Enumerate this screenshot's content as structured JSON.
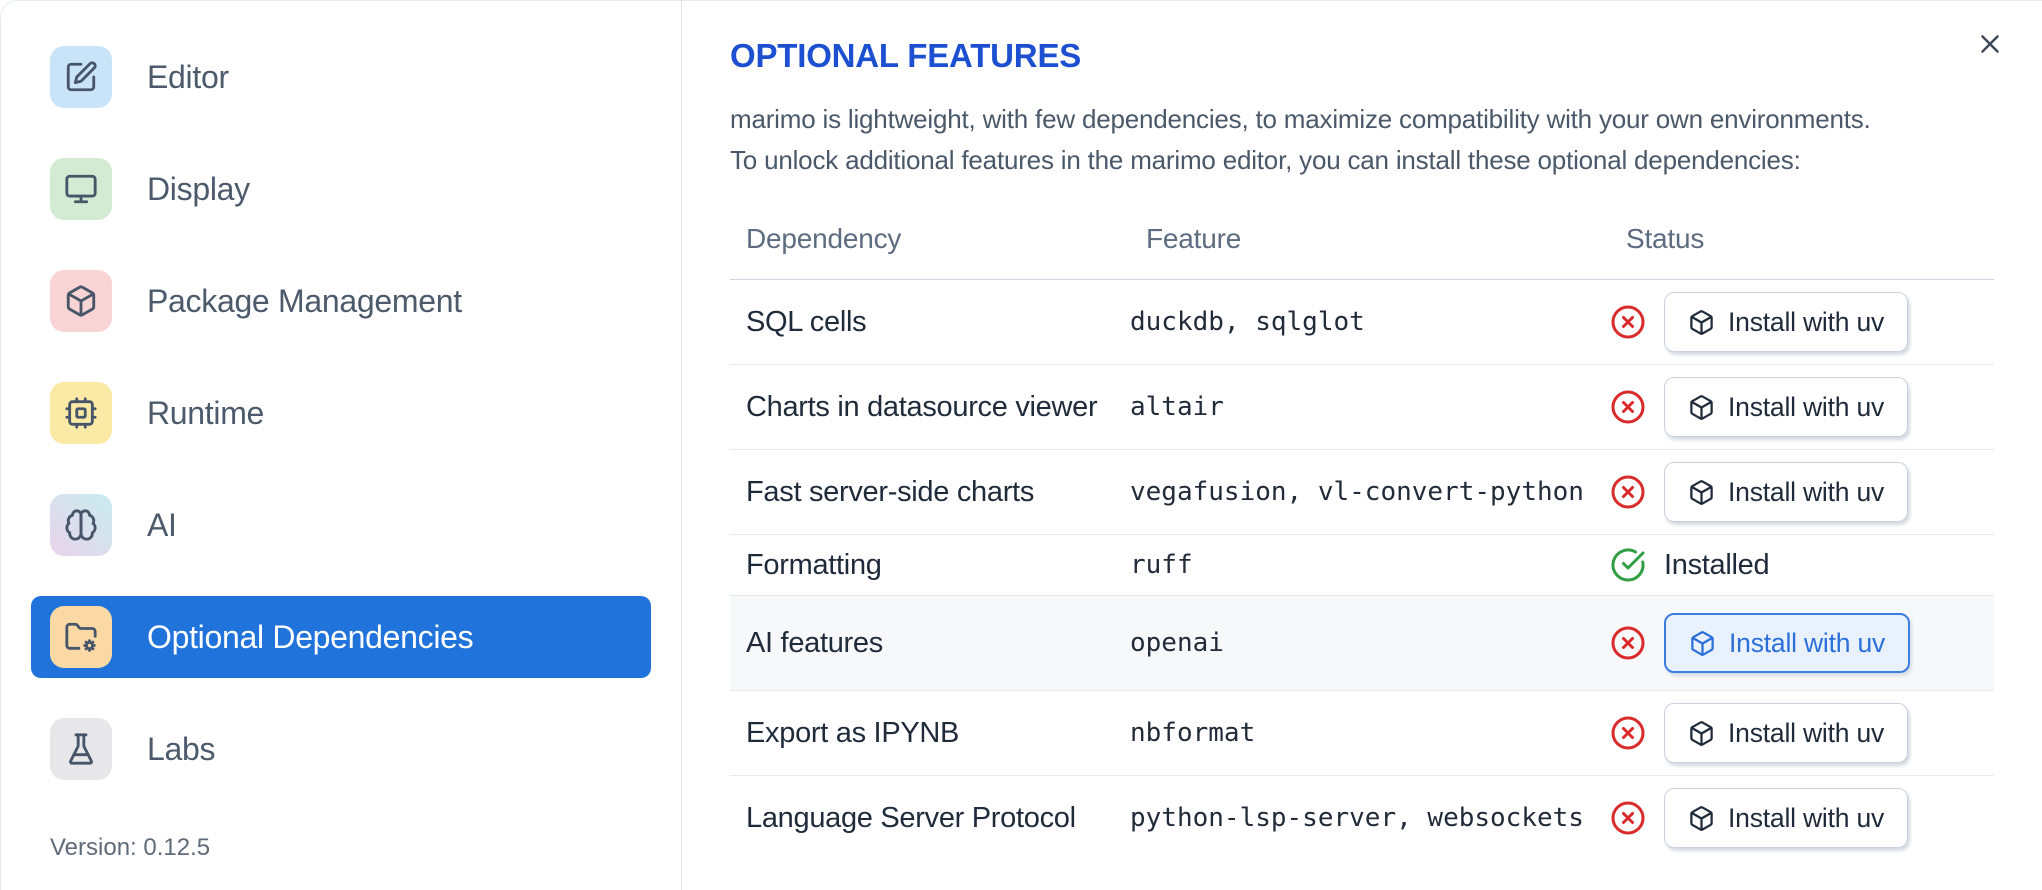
{
  "dialog": {
    "close_icon": "x"
  },
  "sidebar": {
    "items": [
      {
        "label": "Editor",
        "icon": "square-pen",
        "tile_bg": "#c9e4f8",
        "selected": false
      },
      {
        "label": "Display",
        "icon": "monitor",
        "tile_bg": "#d3ead3",
        "selected": false
      },
      {
        "label": "Package Management",
        "icon": "box",
        "tile_bg": "#f9d4d4",
        "selected": false
      },
      {
        "label": "Runtime",
        "icon": "cpu",
        "tile_bg": "#fbe9a6",
        "selected": false
      },
      {
        "label": "AI",
        "icon": "brain",
        "tile_bg": "linear-gradient(45deg,#e9d3ec 0%,#c8ecef 100%)",
        "selected": false
      },
      {
        "label": "Optional Dependencies",
        "icon": "folder-cog",
        "tile_bg": "#fbd9a4",
        "selected": true
      },
      {
        "label": "Labs",
        "icon": "flask",
        "tile_bg": "#e7e7ea",
        "selected": false
      }
    ],
    "selected_bg": "#2173dc",
    "version_label": "Version: 0.12.5"
  },
  "main": {
    "title": "OPTIONAL FEATURES",
    "title_color": "#1d50d0",
    "description_line1": "marimo is lightweight, with few dependencies, to maximize compatibility with your own environments.",
    "description_line2": "To unlock additional features in the marimo editor, you can install these optional dependencies:",
    "table": {
      "headers": [
        "Dependency",
        "Feature",
        "Status"
      ],
      "install_button_label": "Install with uv",
      "installed_label": "Installed",
      "status_colors": {
        "not_installed": "#d92b2b",
        "installed": "#2f9e44"
      },
      "rows": [
        {
          "dependency": "SQL cells",
          "feature": "duckdb, sqlglot",
          "installed": false,
          "highlighted": false
        },
        {
          "dependency": "Charts in datasource viewer",
          "feature": "altair",
          "installed": false,
          "highlighted": false
        },
        {
          "dependency": "Fast server-side charts",
          "feature": "vegafusion, vl-convert-python",
          "installed": false,
          "highlighted": false
        },
        {
          "dependency": "Formatting",
          "feature": "ruff",
          "installed": true,
          "highlighted": false
        },
        {
          "dependency": "AI features",
          "feature": "openai",
          "installed": false,
          "highlighted": true
        },
        {
          "dependency": "Export as IPYNB",
          "feature": "nbformat",
          "installed": false,
          "highlighted": false
        },
        {
          "dependency": "Language Server Protocol",
          "feature": "python-lsp-server, websockets",
          "installed": false,
          "highlighted": false
        }
      ]
    }
  }
}
